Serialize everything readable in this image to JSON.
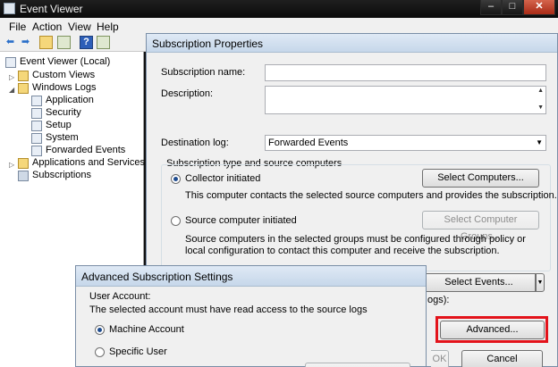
{
  "window": {
    "title": "Event Viewer",
    "min": "–",
    "max": "□",
    "close": "✕"
  },
  "menu": [
    "File",
    "Action",
    "View",
    "Help"
  ],
  "tree": {
    "root": "Event Viewer (Local)",
    "custom_views": "Custom Views",
    "windows_logs": "Windows Logs",
    "logs": [
      "Application",
      "Security",
      "Setup",
      "System",
      "Forwarded Events"
    ],
    "apps_services": "Applications and Services Lo",
    "subscriptions": "Subscriptions"
  },
  "subscription_dialog": {
    "title": "Subscription Properties",
    "name_label": "Subscription name:",
    "name_value": "",
    "description_label": "Description:",
    "description_value": "",
    "destination_label": "Destination log:",
    "destination_value": "Forwarded Events",
    "type_group_label": "Subscription type and source computers",
    "collector_label": "Collector initiated",
    "collector_desc": "This computer contacts the selected source computers and provides the subscription.",
    "select_computers": "Select Computers...",
    "source_label": "Source computer initiated",
    "source_desc_line1": "Source computers in the selected groups must be configured through policy or",
    "source_desc_line2": "local configuration to contact this computer and receive the subscription.",
    "select_groups": "Select Computer Groups...",
    "select_events": "Select Events...",
    "logs_fragment": "ogs):",
    "advanced": "Advanced...",
    "ok": "OK",
    "cancel": "Cancel"
  },
  "advanced_dialog": {
    "title": "Advanced Subscription Settings",
    "user_account_label": "User Account:",
    "user_account_desc": "The selected account must have read access to the source logs",
    "machine_account": "Machine Account",
    "specific_user": "Specific User"
  }
}
